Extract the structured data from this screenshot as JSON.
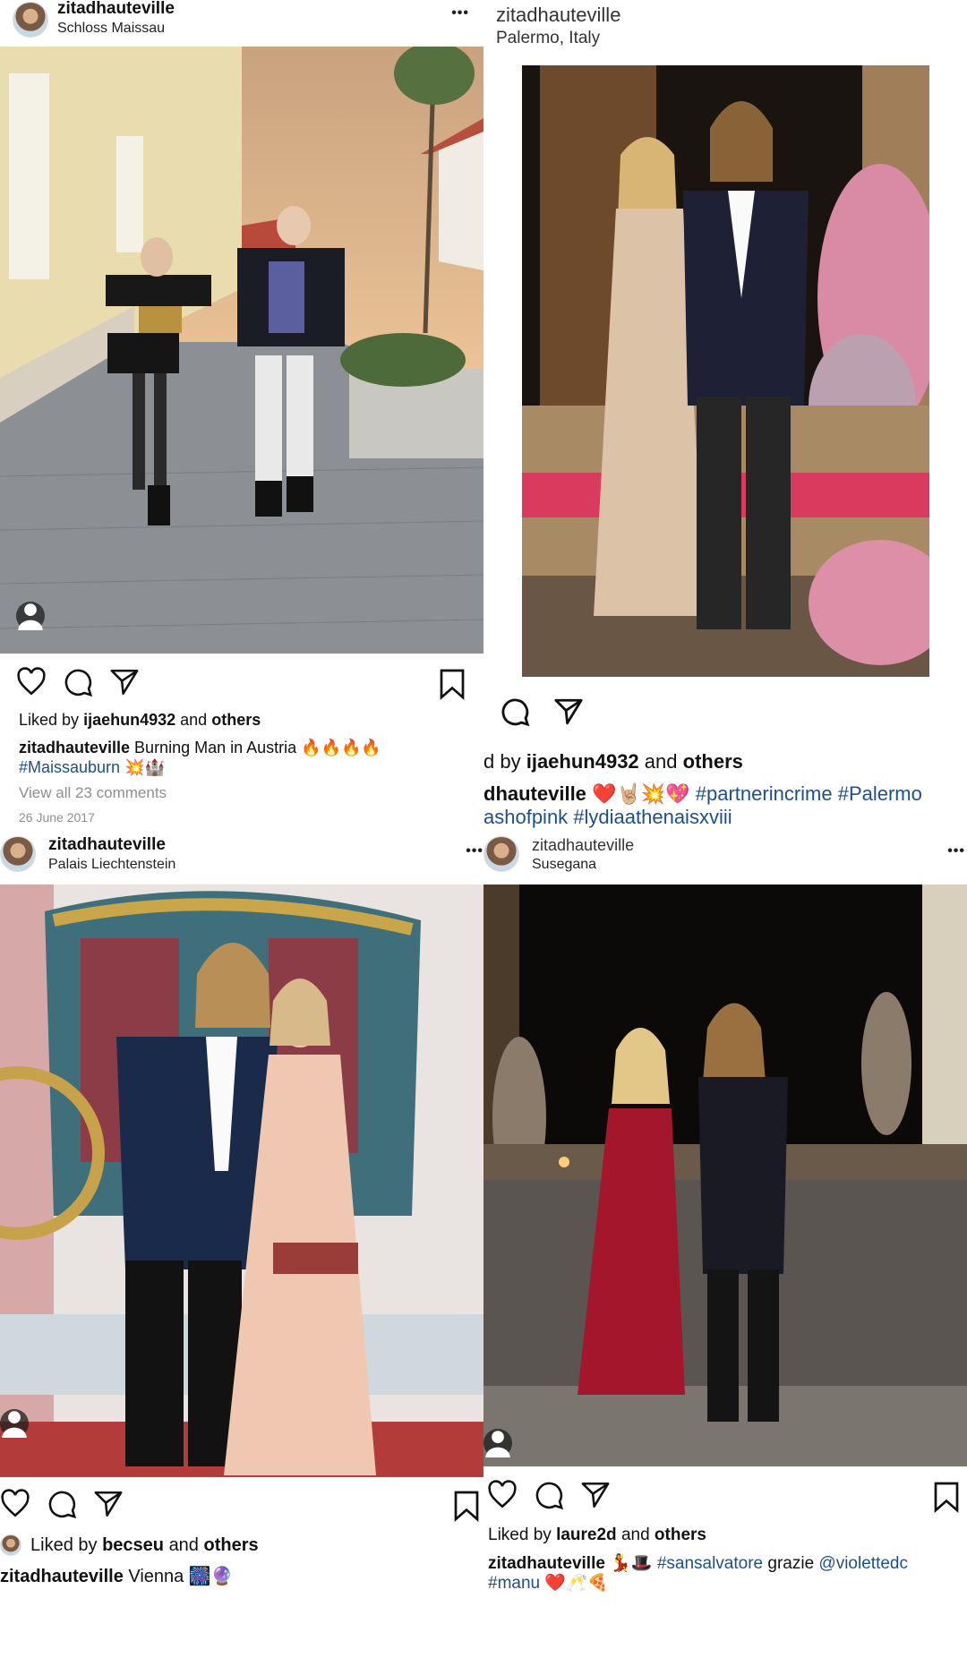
{
  "posts": [
    {
      "username": "zitadhauteville",
      "location": "Schloss Maissau",
      "more_label": "•••",
      "liked_prefix": "Liked by",
      "liked_user": "ijaehun4932",
      "liked_mid": "and",
      "liked_others": "others",
      "caption_user": "zitadhauteville",
      "caption_text": "Burning Man in Austria 🔥🔥🔥🔥",
      "caption_line2_tag": "#Maissauburn",
      "caption_line2_emoji": "💥🏰",
      "comments_link": "View all 23 comments",
      "date": "26 June 2017"
    },
    {
      "username": "zitadhauteville",
      "location": "Palermo, Italy",
      "liked_text_partial": "d by",
      "liked_user": "ijaehun4932",
      "liked_mid": "and",
      "liked_others": "others",
      "caption_user_partial": "dhauteville",
      "caption_emoji": "❤️🤘🏼💥💖",
      "caption_tags": "#partnerincrime #Palermo",
      "caption_line2": "ashofpink #lydiaathenaisxviii"
    },
    {
      "username": "zitadhauteville",
      "location": "Palais Liechtenstein",
      "more_label": "•••",
      "liked_prefix": "Liked by",
      "liked_user": "becseu",
      "liked_mid": "and",
      "liked_others": "others",
      "caption_user": "zitadhauteville",
      "caption_text": "Vienna 🎆🔮"
    },
    {
      "username": "zitadhauteville",
      "location": "Susegana",
      "more_label": "•••",
      "liked_prefix": "Liked by",
      "liked_user": "laure2d",
      "liked_mid": "and",
      "liked_others": "others",
      "caption_user": "zitadhauteville",
      "caption_emoji": "💃🎩",
      "caption_tag1": "#sansalvatore",
      "caption_word": "grazie",
      "caption_mention": "@violettedc",
      "caption_line2_tag": "#manu",
      "caption_line2_emoji": "❤️🥂🍕"
    }
  ],
  "icons": [
    "heart-icon",
    "comment-icon",
    "share-icon",
    "bookmark-icon",
    "more-icon",
    "tagged-user-icon"
  ],
  "colors": {
    "link_blue": "#1e4f8a",
    "muted_gray": "#8e8e8e",
    "text": "#111111"
  }
}
